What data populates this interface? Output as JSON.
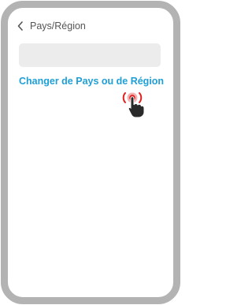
{
  "header": {
    "title": "Pays/Région",
    "back_icon": "chevron-left-icon"
  },
  "country_field": {
    "value": ""
  },
  "change_link": {
    "label": "Changer de Pays ou de Région"
  },
  "tap_indicator": {
    "icon": "tap-hand-icon",
    "pulse_color": "#e02020"
  },
  "colors": {
    "link": "#1e9fd6",
    "frame": "#b3b3b3",
    "field_background": "#ececec"
  }
}
